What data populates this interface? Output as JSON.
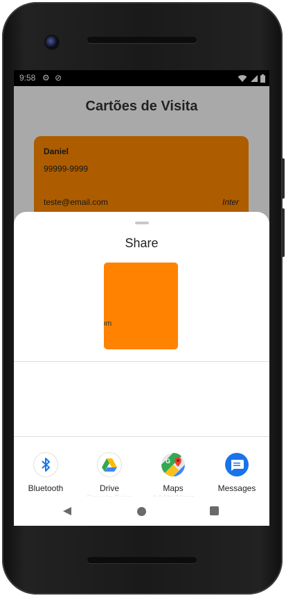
{
  "status_bar": {
    "time": "9:58",
    "left_icons": [
      "gear-icon",
      "sync-icon"
    ],
    "right_icons": [
      "wifi-icon",
      "signal-icon",
      "battery-icon"
    ]
  },
  "app": {
    "title": "Cartões de Visita",
    "card": {
      "name": "Daniel",
      "phone": "99999-9999",
      "email": "teste@email.com",
      "company": "Inter",
      "color": "#ff8a00"
    }
  },
  "share_sheet": {
    "title": "Share",
    "preview_text": "om",
    "preview_color": "#ff8200",
    "apps": [
      {
        "label": "Bluetooth",
        "sub": "",
        "icon": "bluetooth-icon"
      },
      {
        "label": "Drive",
        "sub": "Save to Drive",
        "icon": "google-drive-icon"
      },
      {
        "label": "Maps",
        "sub": "Add to Maps",
        "icon": "google-maps-icon"
      },
      {
        "label": "Messages",
        "sub": "",
        "icon": "messages-icon"
      }
    ]
  },
  "nav_bar": {
    "icons": [
      "back-icon",
      "home-icon",
      "recents-icon"
    ]
  }
}
